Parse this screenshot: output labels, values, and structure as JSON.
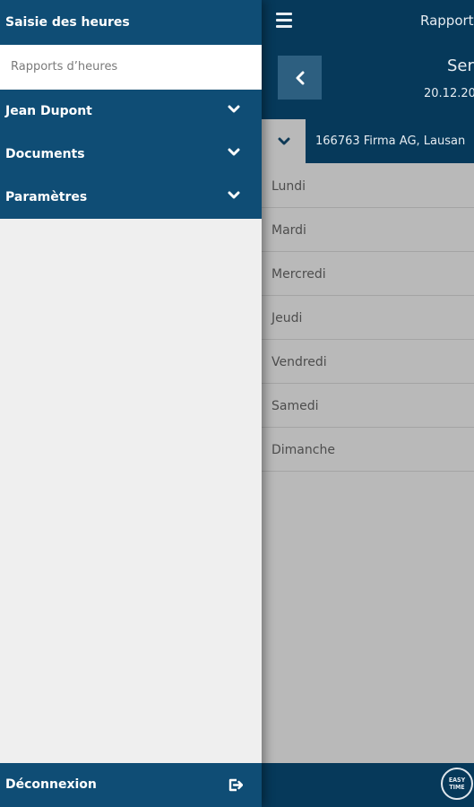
{
  "drawer": {
    "title": "Saisie des heures",
    "link": "Rapports d’heures",
    "items": [
      {
        "label": "Jean Dupont"
      },
      {
        "label": "Documents"
      },
      {
        "label": "Paramètres"
      }
    ],
    "logout": "Déconnexion"
  },
  "app": {
    "title": "Rapport",
    "week_title": "Ser",
    "week_date": "20.12.20",
    "project": "166763 Firma AG, Lausan",
    "days": [
      "Lundi",
      "Mardi",
      "Mercredi",
      "Jeudi",
      "Vendredi",
      "Samedi",
      "Dimanche"
    ],
    "logo_line1": "EASY",
    "logo_line2": "TIME"
  },
  "colors": {
    "drawer_blue": "#0f4d75",
    "header_navy": "#06395a",
    "back_button": "#2d5f80"
  },
  "icons": [
    "hamburger-icon",
    "chevron-left-icon",
    "chevron-down-icon",
    "logout-icon",
    "easy-time-logo"
  ]
}
